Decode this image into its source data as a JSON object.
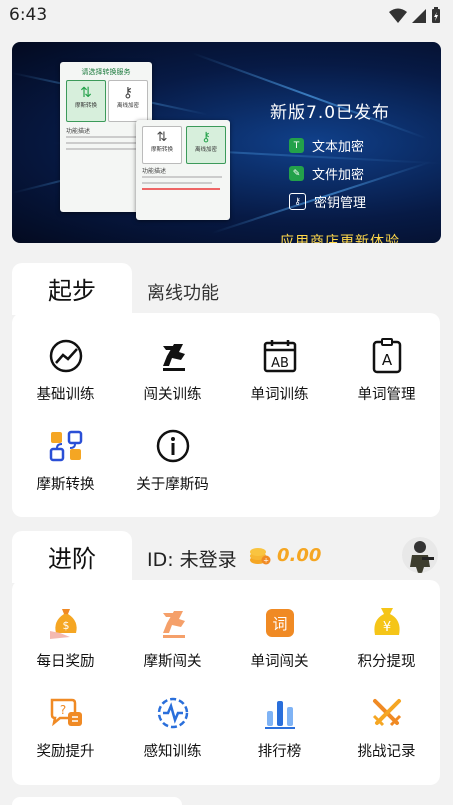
{
  "status": {
    "time": "6:43"
  },
  "banner": {
    "title": "新版7.0已发布",
    "features": [
      "文本加密",
      "文件加密",
      "密钥管理"
    ],
    "footer": "应用商店更新体验",
    "shot1": {
      "header": "请选择转换服务",
      "tile1": "摩斯转换",
      "tile2": "离线加密",
      "section": "功能描述"
    },
    "shot2": {
      "tile1": "摩斯转换",
      "tile2": "离线加密",
      "section": "功能描述"
    }
  },
  "basic": {
    "tab_active": "起步",
    "tab_other": "离线功能",
    "items": [
      {
        "label": "基础训练",
        "icon": "trend-chart-icon"
      },
      {
        "label": "闯关训练",
        "icon": "runner-icon"
      },
      {
        "label": "单词训练",
        "icon": "calendar-ab-icon"
      },
      {
        "label": "单词管理",
        "icon": "clipboard-a-icon"
      },
      {
        "label": "摩斯转换",
        "icon": "convert-icon"
      },
      {
        "label": "关于摩斯码",
        "icon": "info-icon"
      }
    ]
  },
  "advanced": {
    "tab_active": "进阶",
    "user_id": "ID: 未登录",
    "points": "0.00",
    "items": [
      {
        "label": "每日奖励",
        "icon": "money-bag-icon"
      },
      {
        "label": "摩斯闯关",
        "icon": "runner-icon"
      },
      {
        "label": "单词闯关",
        "icon": "word-icon"
      },
      {
        "label": "积分提现",
        "icon": "yen-bag-icon"
      },
      {
        "label": "奖励提升",
        "icon": "question-chat-icon"
      },
      {
        "label": "感知训练",
        "icon": "pulse-icon"
      },
      {
        "label": "排行榜",
        "icon": "bar-chart-icon"
      },
      {
        "label": "挑战记录",
        "icon": "crossed-swords-icon"
      }
    ]
  },
  "colors": {
    "green": "#23a14a",
    "orange": "#f08a24",
    "blue": "#2a6fdb",
    "gold": "#f5a623"
  }
}
